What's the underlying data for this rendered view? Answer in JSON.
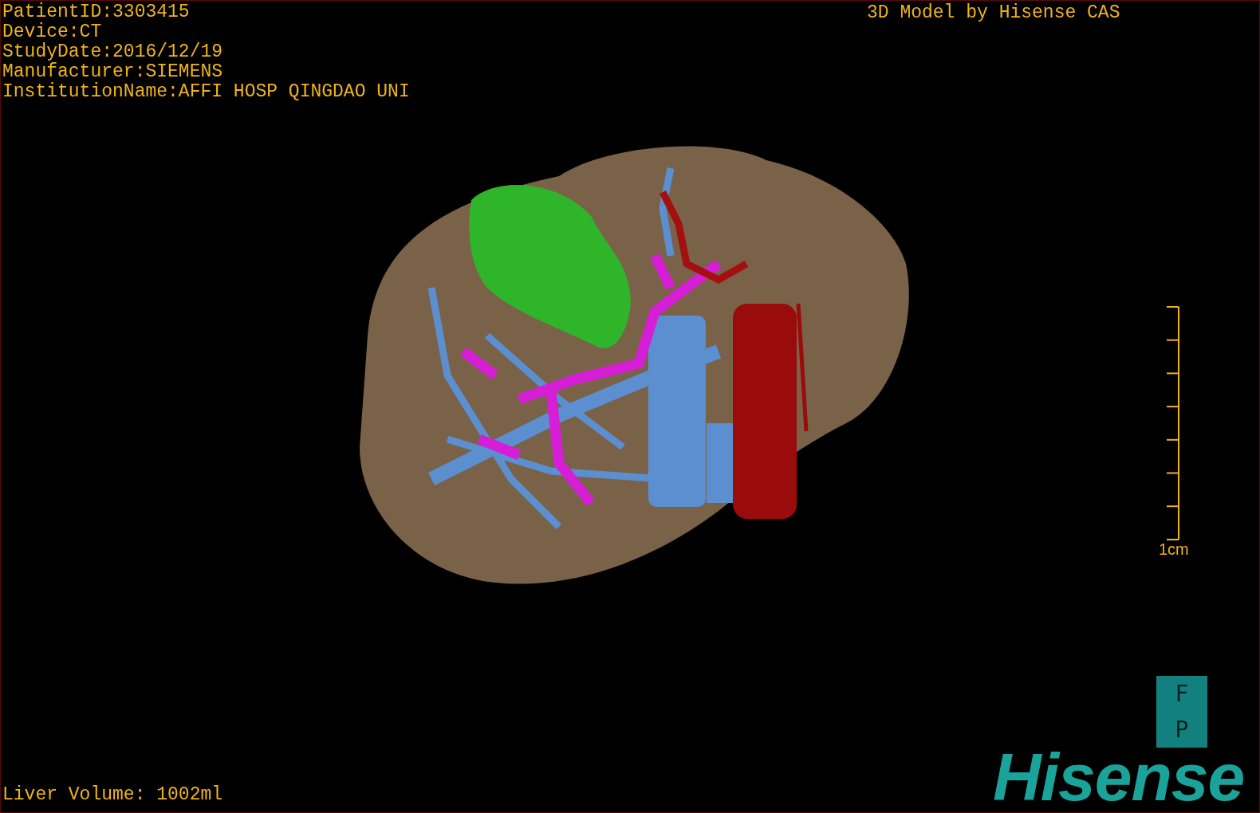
{
  "patient_info": [
    "PatientID:3303415",
    "Device:CT",
    "StudyDate:2016/12/19",
    "Manufacturer:SIEMENS",
    "InstitutionName:AFFI HOSP QINGDAO UNI"
  ],
  "header_right": "3D Model by Hisense CAS",
  "scale_bar": {
    "label": "1cm"
  },
  "orientation_marker": {
    "letters": [
      "F",
      "P"
    ]
  },
  "logo": "Hisense",
  "liver_volume": "Liver Volume: 1002ml"
}
